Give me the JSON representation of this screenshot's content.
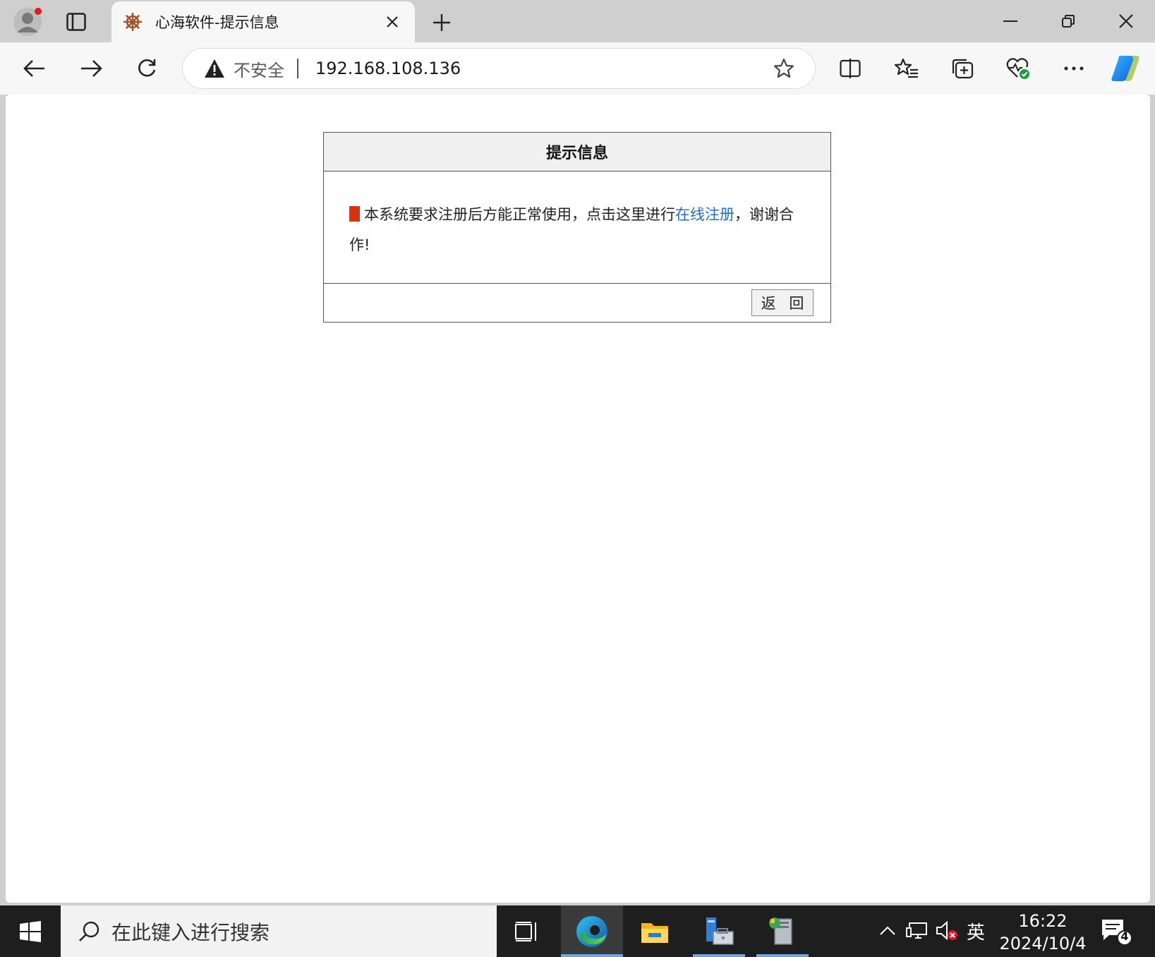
{
  "browser": {
    "tab": {
      "title": "心海软件-提示信息"
    },
    "address_bar": {
      "security_label": "不安全",
      "url": "192.168.108.136"
    }
  },
  "page": {
    "dialog": {
      "title": "提示信息",
      "message_before_link": "本系统要求注册后方能正常使用，点击这里进行",
      "link_text": "在线注册",
      "message_after_link": "，谢谢合作!",
      "back_button": "返 回"
    }
  },
  "taskbar": {
    "search_placeholder": "在此键入进行搜索",
    "ime_indicator": "英",
    "clock_time": "16:22",
    "clock_date": "2024/10/4",
    "notification_count": "4"
  },
  "colors": {
    "link": "#1f6fc5",
    "marker": "#d8330f",
    "taskbar": "#1e1e1e"
  }
}
